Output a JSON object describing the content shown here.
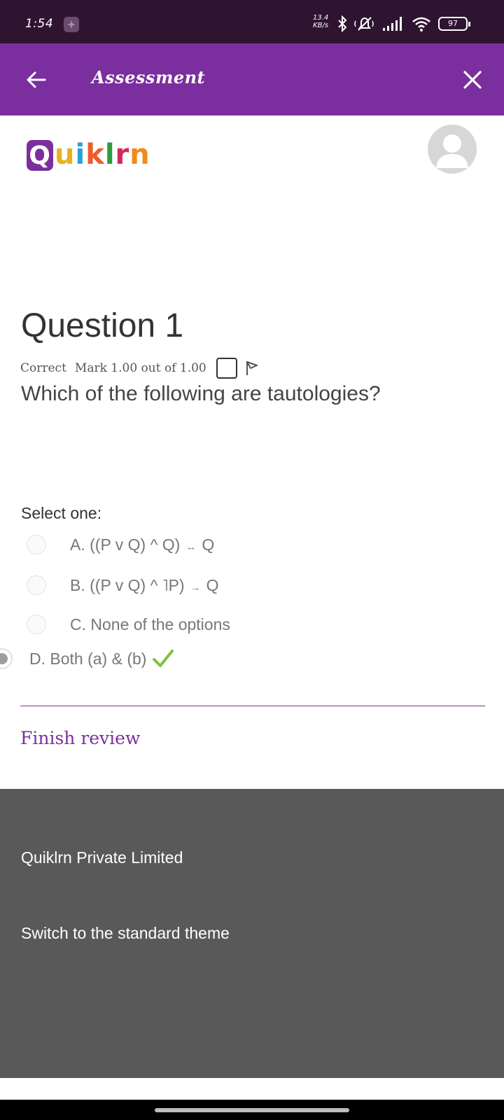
{
  "status_bar": {
    "time": "1:54",
    "speed_value": "13.4",
    "speed_unit": "KB/s",
    "battery": "97",
    "icons": [
      "bluetooth-icon",
      "mute-icon",
      "signal-icon",
      "wifi-icon",
      "battery-icon"
    ]
  },
  "app_bar": {
    "title": "Assessment",
    "back_icon": "arrow-left-icon",
    "close_icon": "close-icon",
    "color": "#7b2f9e"
  },
  "header": {
    "logo_letters": [
      "Q",
      "u",
      "i",
      "k",
      "l",
      "r",
      "n"
    ],
    "logo_colors": [
      "#7b2f9e",
      "#e8b21e",
      "#29a0d8",
      "#ec5d2a",
      "#2e9b3e",
      "#d8265a",
      "#f08a1e"
    ]
  },
  "question": {
    "title": "Question 1",
    "status": "Correct",
    "mark": "Mark 1.00 out of 1.00",
    "text": "Which of the following are tautologies?",
    "prompt": "Select one:",
    "answers": [
      {
        "prefix": "A. ((P v Q) ^ Q)",
        "arrow": "↔",
        "suffix": "Q"
      },
      {
        "prefix": "B. ((P v Q) ^ ˥P)",
        "arrow": "→",
        "suffix": "Q"
      },
      {
        "label": "C. None of the options"
      },
      {
        "label": "D. Both (a) & (b)",
        "selected": true,
        "correct": true
      }
    ],
    "check_color": "#7cc243"
  },
  "actions": {
    "finish_review": "Finish review"
  },
  "footer": {
    "company": "Quiklrn Private Limited",
    "theme_link": "Switch to the standard theme"
  }
}
